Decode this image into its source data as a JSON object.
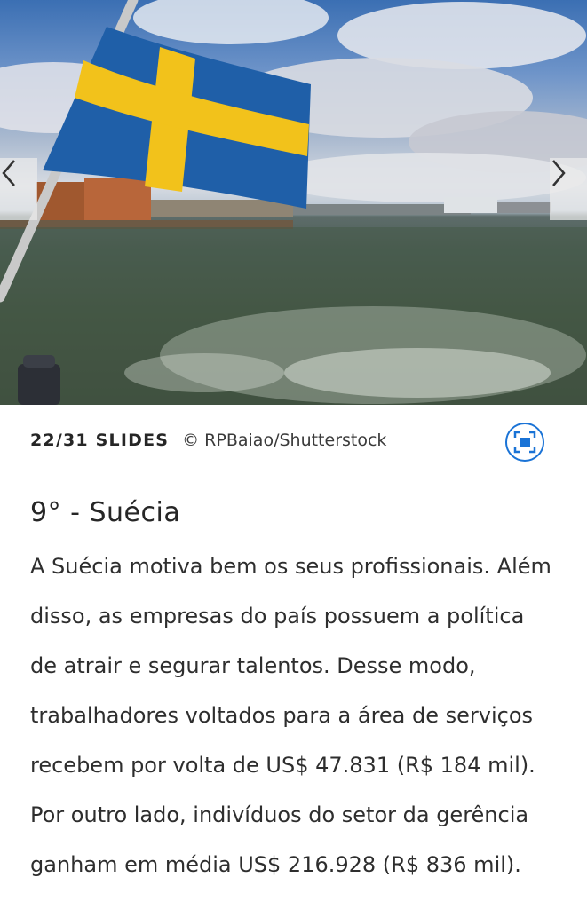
{
  "slide": {
    "counter": "22/31 SLIDES",
    "credit": "© RPBaiao/Shutterstock",
    "title": "9° - Suécia",
    "paragraph_lines": [
      "A Suécia motiva bem os seus profissionais. Além",
      "disso, as empresas do país possuem a política",
      "de atrair e segurar talentos. Desse modo,",
      "trabalhadores voltados para a área de serviços",
      "recebem por volta de US$ 47.831 (R$ 184 mil).",
      "Por outro lado, indivíduos do setor da gerência",
      "ganham em média US$ 216.928 (R$ 836 mil)."
    ]
  },
  "image": {
    "subject": "Swedish flag on boat over harbor water"
  },
  "icons": {
    "prev": "chevron-left-icon",
    "next": "chevron-right-icon",
    "expand": "fullscreen-icon"
  },
  "colors": {
    "accent": "#1a73d6",
    "flag_blue": "#1f5fa8",
    "flag_yellow": "#f2c21b",
    "text": "#262626"
  }
}
